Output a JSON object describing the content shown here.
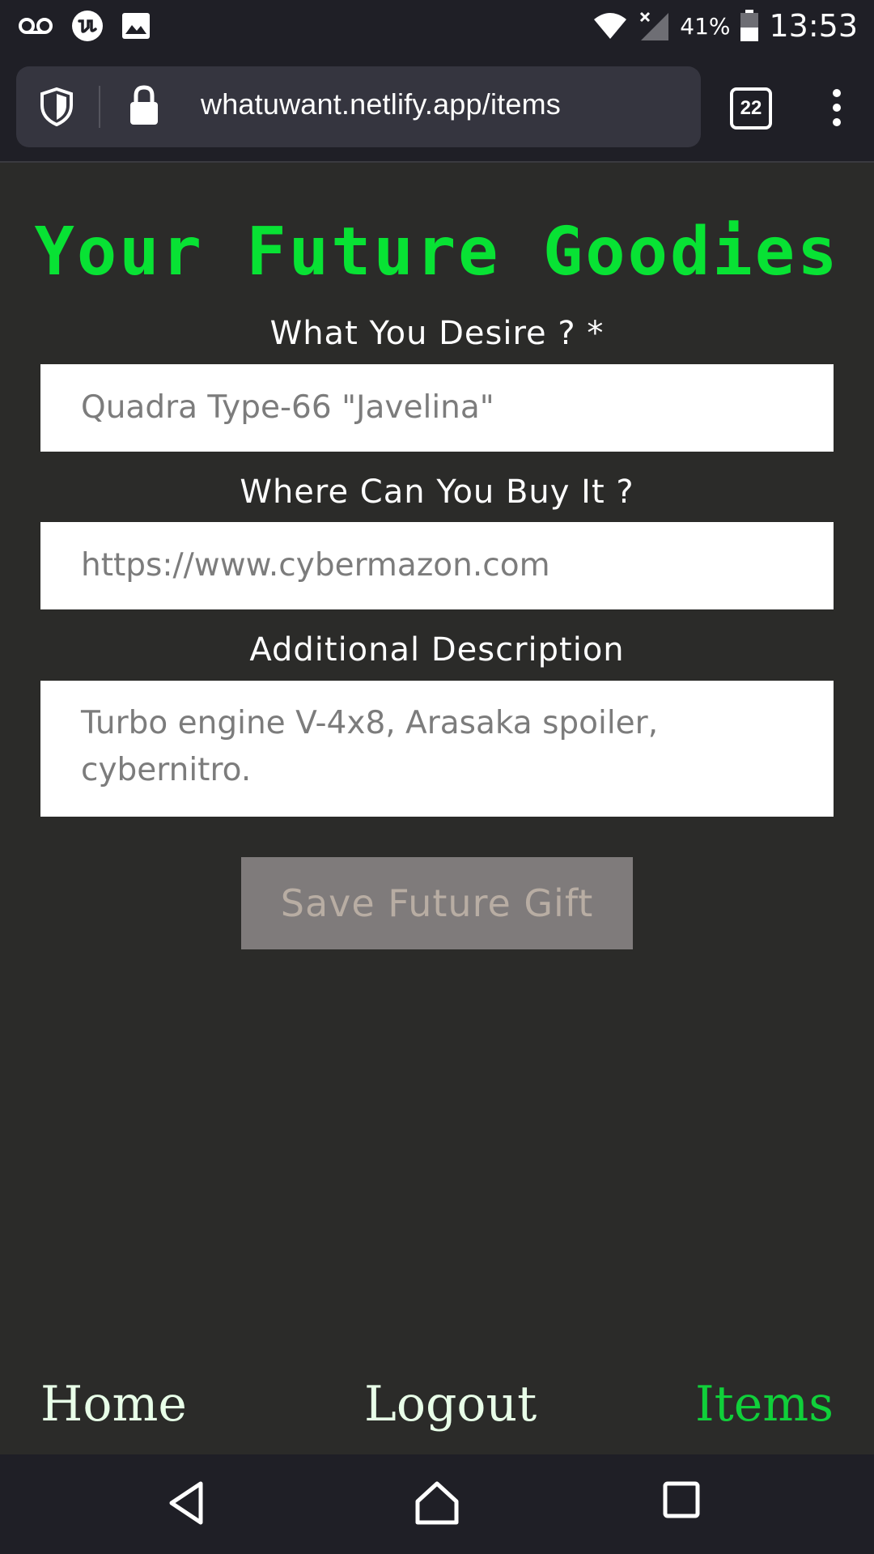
{
  "status_bar": {
    "icons_left": [
      "voicemail-icon",
      "app-notification-icon",
      "image-icon"
    ],
    "icons_right": [
      "wifi-icon",
      "signal-icon",
      "battery-icon"
    ],
    "battery": "41%",
    "time": "13:53"
  },
  "browser": {
    "url": "whatuwant.netlify.app/items",
    "tab_count": "22",
    "icons": [
      "shield-icon",
      "lock-icon",
      "more-vert-icon"
    ]
  },
  "page": {
    "title": "Your Future Goodies",
    "title_color": "#08e234"
  },
  "form": {
    "desire_label": "What You Desire ? *",
    "desire_placeholder": "Quadra Type-66 \"Javelina\"",
    "buy_label": "Where Can You Buy It ?",
    "buy_placeholder": "https://www.cybermazon.com",
    "description_label": "Additional Description",
    "description_placeholder": "Turbo engine V-4x8, Arasaka spoiler, cybernitro.",
    "save_label": "Save Future Gift",
    "save_button_color": "#7f7b7b"
  },
  "bottom_nav": {
    "home": "Home",
    "logout": "Logout",
    "items": "Items",
    "active_color": "#10d03a"
  },
  "android_nav": {
    "icons": [
      "back-icon",
      "home-icon",
      "recents-icon"
    ]
  }
}
